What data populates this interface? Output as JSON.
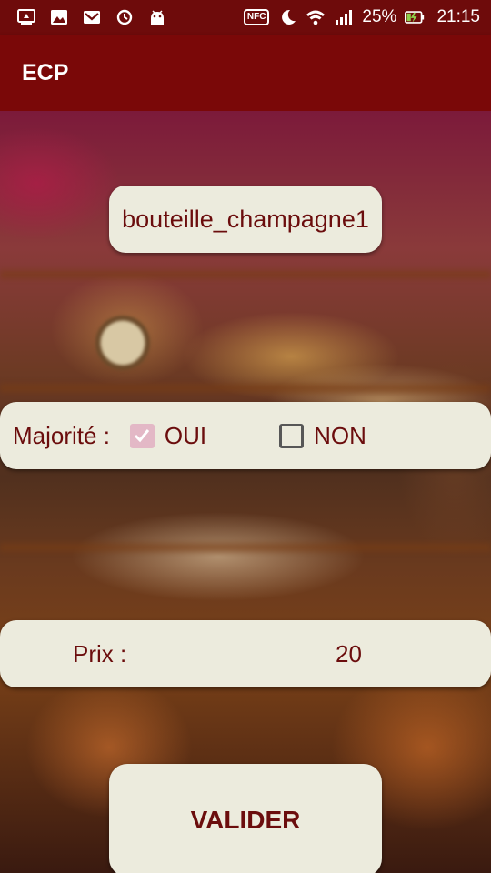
{
  "status_bar": {
    "battery_percent": "25%",
    "time": "21:15",
    "nfc_label": "NFC",
    "icons": [
      "screen-mirror-icon",
      "image-icon",
      "gmail-icon",
      "sync-icon",
      "android-icon",
      "nfc-icon",
      "moon-icon",
      "wifi-icon",
      "signal-icon",
      "battery-charging-icon"
    ]
  },
  "app_bar": {
    "title": "ECP"
  },
  "form": {
    "product_name": "bouteille_champagne1",
    "majority": {
      "label": "Majorité :",
      "yes_label": "OUI",
      "yes_checked": true,
      "no_label": "NON",
      "no_checked": false
    },
    "price": {
      "label": "Prix :",
      "value": "20"
    },
    "submit_label": "VALIDER"
  },
  "colors": {
    "status_bar": "#6e0b0b",
    "app_bar": "#7a0808",
    "pill_background": "#ecebdd",
    "text_accent": "#6b0d0d",
    "checkbox_checked": "#e3b8c6"
  }
}
